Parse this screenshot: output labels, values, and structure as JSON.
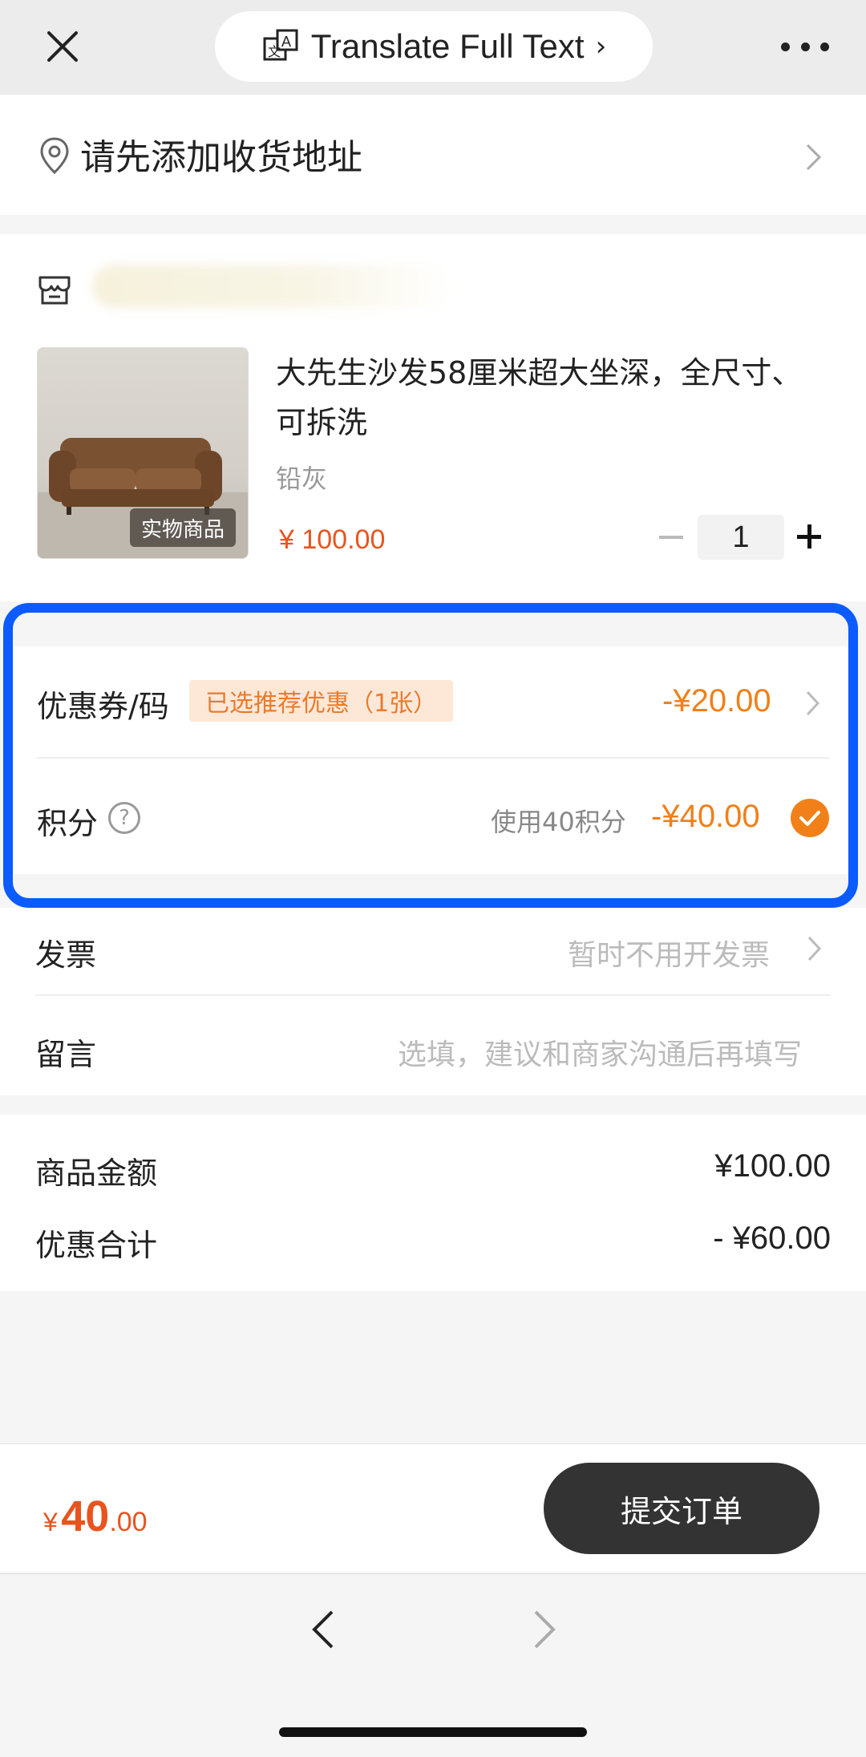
{
  "browser_bar": {
    "translate_label": "Translate Full Text",
    "translate_chevron": "›"
  },
  "address": {
    "prompt": "请先添加收货地址"
  },
  "product": {
    "title": "大先生沙发58厘米超大坐深，全尺寸、可拆洗",
    "variant": "铅灰",
    "tag": "实物商品",
    "price": "¥ 100.00",
    "quantity": "1"
  },
  "discounts": {
    "coupon_label": "优惠券/码",
    "coupon_badge": "已选推荐优惠（1张）",
    "coupon_value": "-¥20.00",
    "points_label": "积分",
    "points_help": "?",
    "points_used": "使用40积分",
    "points_value": "-¥40.00",
    "points_checked": true
  },
  "invoice": {
    "label": "发票",
    "value": "暂时不用开发票"
  },
  "message": {
    "label": "留言",
    "placeholder": "选填，建议和商家沟通后再填写"
  },
  "summary": {
    "goods_label": "商品金额",
    "goods_value": "¥100.00",
    "discount_label": "优惠合计",
    "discount_value": "- ¥60.00"
  },
  "checkout": {
    "currency": "¥",
    "total_int": "40",
    "total_dec": ".00",
    "submit_label": "提交订单"
  },
  "colors": {
    "accent_orange": "#f08019",
    "price_red": "#e8541e",
    "highlight_blue": "#0b5bff",
    "submit_bg": "#333333"
  },
  "icons": [
    "close-icon",
    "translate-icon",
    "more-icon",
    "location-pin-icon",
    "chevron-right-icon",
    "shop-icon",
    "minus-icon",
    "plus-icon",
    "help-icon",
    "check-icon",
    "back-arrow-icon",
    "forward-arrow-icon"
  ]
}
